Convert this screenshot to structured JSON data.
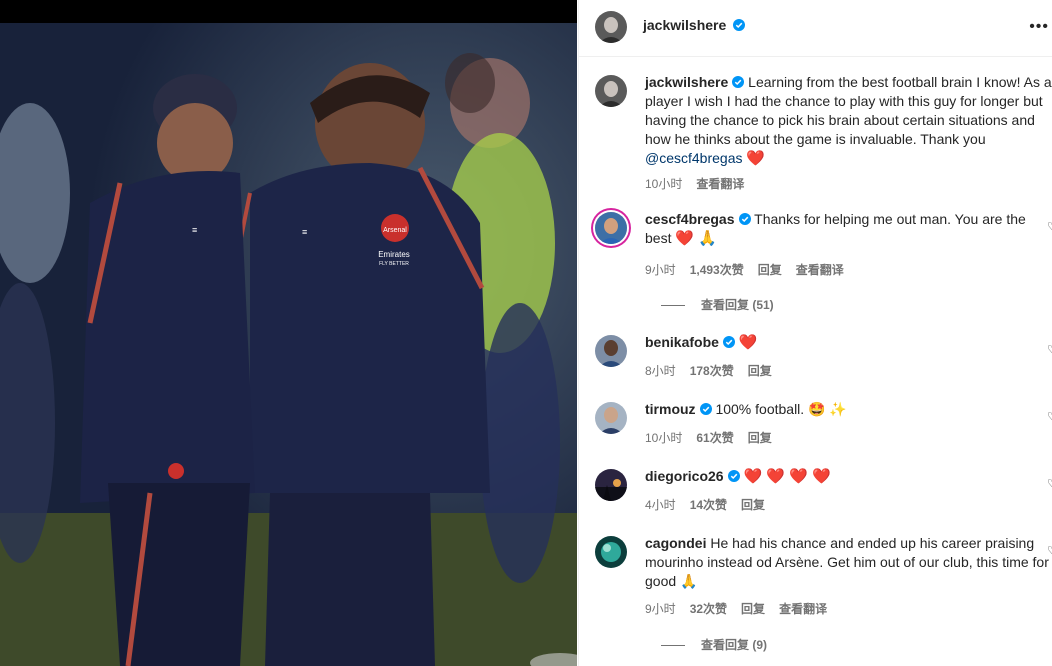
{
  "post": {
    "author": "jackwilshere",
    "more_icon": "more-horizontal-icon",
    "caption_username": "jackwilshere",
    "caption": "Learning from the best football brain I know! As a player I wish I had the chance to play with this guy for longer but having the chance to pick his brain about certain situations and how he thinks about the game is invaluable. Thank you",
    "caption_mention": "@cescf4bregas",
    "caption_emoji": "❤️",
    "caption_time": "10小时",
    "caption_translate": "查看翻译",
    "photo_badge_text": "Arsenal",
    "photo_sponsor_line1": "Emirates",
    "photo_sponsor_line2": "FLY BETTER"
  },
  "comments": [
    {
      "username": "cescf4bregas",
      "text": "Thanks for helping me out man. You are the best",
      "emoji": "❤️ 🙏",
      "time": "9小时",
      "likes": "1,493次赞",
      "reply": "回复",
      "translate": "查看翻译",
      "view_replies": "查看回复 (51)"
    },
    {
      "username": "benikafobe",
      "text": "",
      "emoji": "❤️",
      "time": "8小时",
      "likes": "178次赞",
      "reply": "回复"
    },
    {
      "username": "tirmouz",
      "text": "100% football.",
      "emoji": "🤩 ✨",
      "time": "10小时",
      "likes": "61次赞",
      "reply": "回复"
    },
    {
      "username": "diegorico26",
      "text": "",
      "emoji": "❤️ ❤️ ❤️ ❤️",
      "time": "4小时",
      "likes": "14次赞",
      "reply": "回复"
    },
    {
      "username": "cagondei",
      "text": "He had his chance and ended up his career praising mourinho instead od Arsène. Get him out of our club, this time for good",
      "emoji": "🙏",
      "time": "9小时",
      "likes": "32次赞",
      "reply": "回复",
      "translate": "查看翻译",
      "view_replies": "查看回复 (9)"
    }
  ],
  "colors": {
    "verified": "#0095f6",
    "link": "#00376b",
    "heart": "#ed2a3a",
    "meta": "#737373"
  }
}
